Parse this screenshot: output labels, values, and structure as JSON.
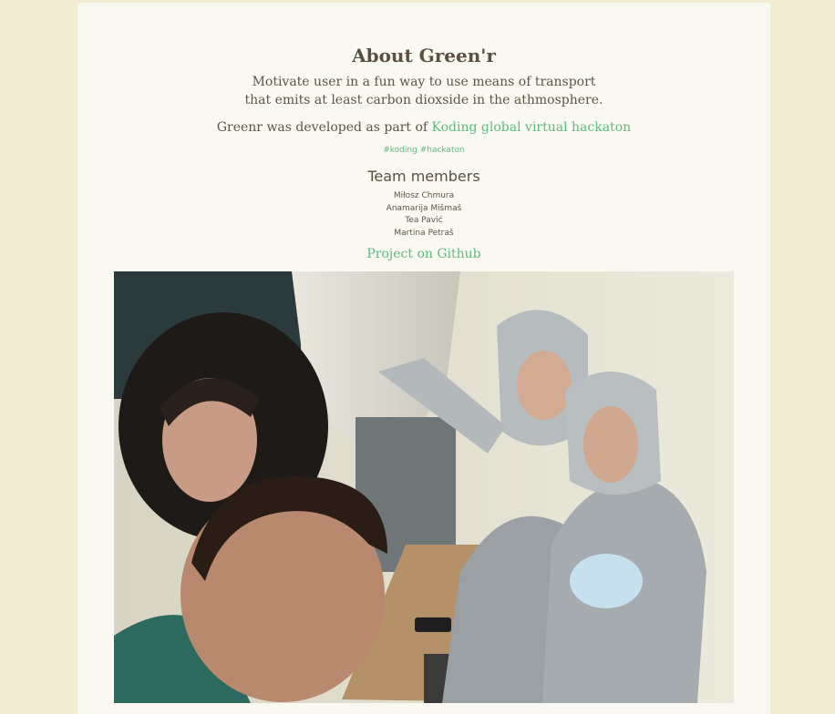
{
  "about": {
    "title": "About Green'r",
    "tagline_line1": "Motivate user in a fun way to use means of transport",
    "tagline_line2": "that emits at least carbon dioxside in the athmosphere.",
    "developed_prefix": "Greenr was developed as part of ",
    "hackathon_link": "Koding global virtual hackaton",
    "tags": [
      "#koding",
      "#hackaton"
    ],
    "team_heading": "Team members",
    "team_members": [
      "Miłosz Chmura",
      "Anamarija Mišmaš",
      "Tea Pavić",
      "Martina Petraš"
    ],
    "github_link": "Project on Github"
  },
  "colors": {
    "page_background": "#f1ecd2",
    "card_background": "#faf9f1",
    "text": "#5e5544",
    "link": "#5fba7d"
  }
}
